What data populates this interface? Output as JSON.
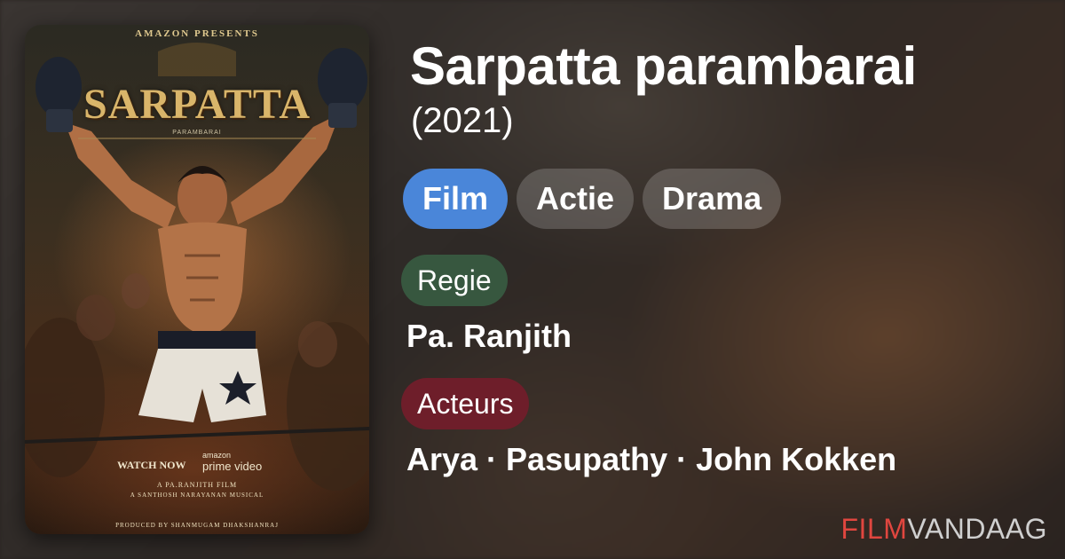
{
  "movie": {
    "title": "Sarpatta parambarai",
    "year": "(2021)"
  },
  "genres": [
    {
      "label": "Film",
      "color": "#4a86d9"
    },
    {
      "label": "Actie",
      "color": "rgba(255,255,255,0.18)"
    },
    {
      "label": "Drama",
      "color": "rgba(255,255,255,0.18)"
    }
  ],
  "director": {
    "label": "Regie",
    "value": "Pa. Ranjith",
    "label_color": "#37573f"
  },
  "cast": {
    "label": "Acteurs",
    "value": "Arya · Pasupathy · John Kokken",
    "label_color": "#6e1e2a"
  },
  "brand": {
    "part1": "FILM",
    "part2": "VANDAAG",
    "color1": "#e0463f",
    "color2": "#cfcfcf"
  },
  "poster": {
    "presents": "AMAZON PRESENTS",
    "title": "SARPATTA",
    "subtitle": "PARAMBARAI",
    "watch_now": "WATCH NOW",
    "amazon": "amazon",
    "prime_video": "prime video",
    "director_credit": "A PA.RANJITH FILM",
    "music_credit": "A SANTHOSH NARAYANAN MUSICAL",
    "producer_credit": "PRODUCED BY SHANMUGAM DHAKSHANRAJ"
  }
}
